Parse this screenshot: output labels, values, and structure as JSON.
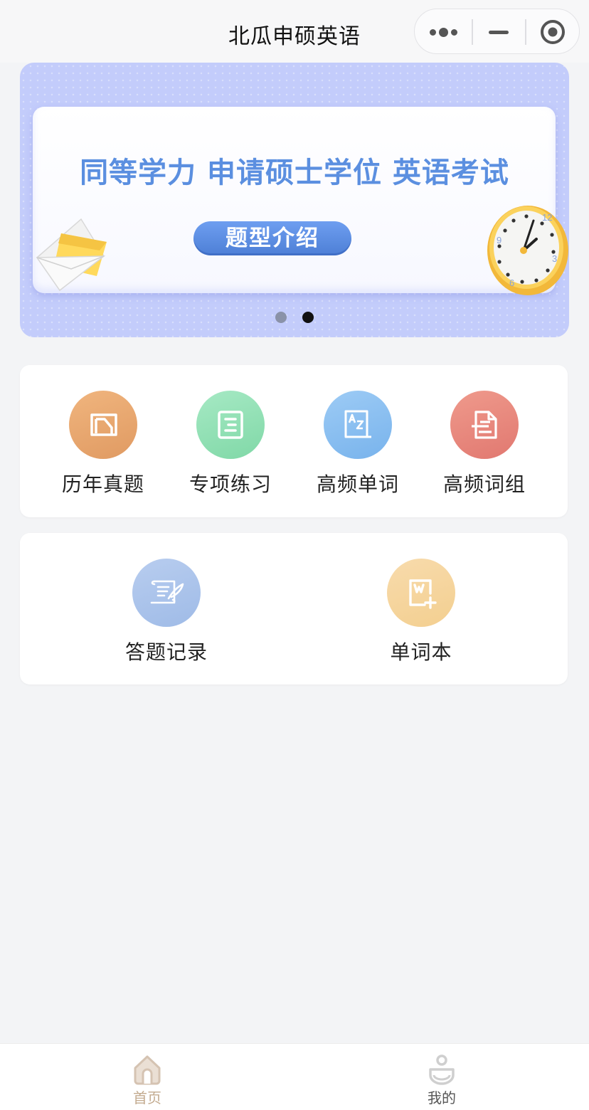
{
  "navbar": {
    "title": "北瓜申硕英语",
    "capsule": {
      "more_icon": "more-dots-icon",
      "minimize_icon": "minimize-icon",
      "close_icon": "target-circle-icon"
    }
  },
  "banner": {
    "headline": "同等学力 申请硕士学位 英语考试",
    "button": "题型介绍",
    "indicators": [
      {
        "active": false
      },
      {
        "active": true
      }
    ],
    "decor": [
      "envelope-icon",
      "clock-icon"
    ],
    "clock_numbers": [
      "12",
      "3",
      "6",
      "9"
    ]
  },
  "features": [
    {
      "label": "历年真题",
      "icon": "folder-doc-icon",
      "color": "#e6a06a"
    },
    {
      "label": "专项练习",
      "icon": "list-doc-icon",
      "color": "#86dcae"
    },
    {
      "label": "高频单词",
      "icon": "az-book-icon",
      "color": "#7fb9ef"
    },
    {
      "label": "高频词组",
      "icon": "phrase-doc-icon",
      "color": "#e57a73"
    }
  ],
  "tools": [
    {
      "label": "答题记录",
      "icon": "scroll-quill-icon",
      "color": "#a9c2eb"
    },
    {
      "label": "单词本",
      "icon": "word-book-add-icon",
      "color": "#f6d49a"
    }
  ],
  "tabbar": {
    "items": [
      {
        "label": "首页",
        "icon": "home-icon",
        "active": true,
        "color": "#c3ab8f"
      },
      {
        "label": "我的",
        "icon": "user-icon",
        "active": false
      }
    ]
  }
}
